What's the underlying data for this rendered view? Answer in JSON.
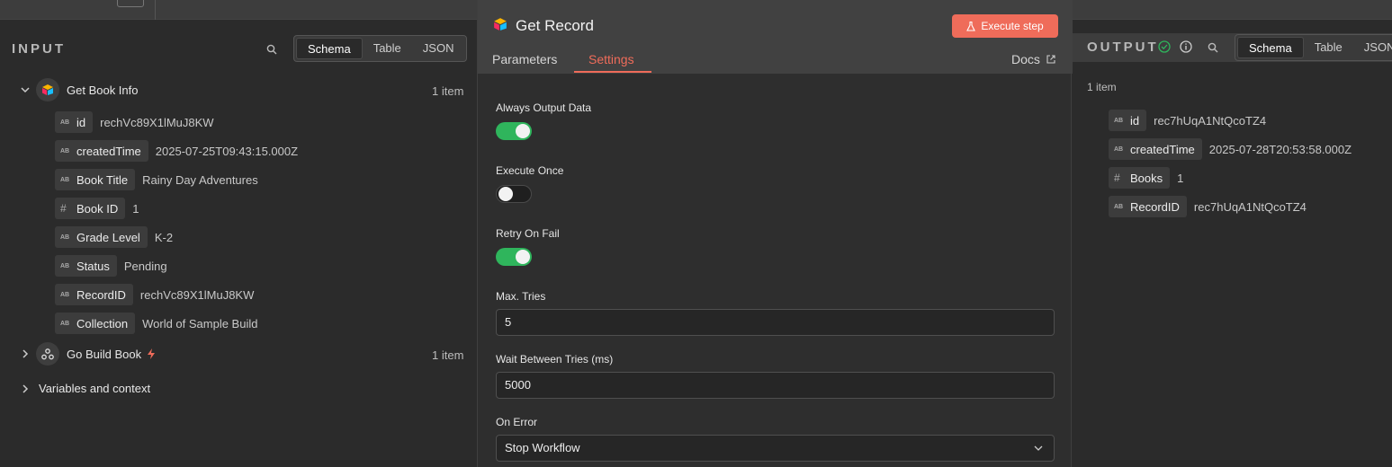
{
  "input": {
    "title": "INPUT",
    "view_tabs": [
      "Schema",
      "Table",
      "JSON"
    ],
    "nodes": [
      {
        "name": "Get Book Info",
        "count": "1 item",
        "fields": [
          {
            "type": "AB",
            "label": "id",
            "value": "rechVc89X1lMuJ8KW"
          },
          {
            "type": "AB",
            "label": "createdTime",
            "value": "2025-07-25T09:43:15.000Z"
          },
          {
            "type": "AB",
            "label": "Book Title",
            "value": "Rainy Day Adventures"
          },
          {
            "type": "#",
            "label": "Book ID",
            "value": "1"
          },
          {
            "type": "AB",
            "label": "Grade Level",
            "value": "K-2"
          },
          {
            "type": "AB",
            "label": "Status",
            "value": "Pending"
          },
          {
            "type": "AB",
            "label": "RecordID",
            "value": "rechVc89X1lMuJ8KW"
          },
          {
            "type": "AB",
            "label": "Collection",
            "value": "World of Sample Build"
          }
        ]
      },
      {
        "name": "Go Build Book",
        "count": "1 item"
      }
    ],
    "variables_label": "Variables and context"
  },
  "center": {
    "title": "Get Record",
    "execute_label": "Execute step",
    "tabs": [
      "Parameters",
      "Settings"
    ],
    "docs_label": "Docs",
    "settings": {
      "always_output": {
        "label": "Always Output Data",
        "on": true
      },
      "execute_once": {
        "label": "Execute Once",
        "on": false
      },
      "retry_on_fail": {
        "label": "Retry On Fail",
        "on": true
      },
      "max_tries": {
        "label": "Max. Tries",
        "value": "5"
      },
      "wait_between": {
        "label": "Wait Between Tries (ms)",
        "value": "5000"
      },
      "on_error": {
        "label": "On Error",
        "value": "Stop Workflow"
      }
    }
  },
  "output": {
    "title": "OUTPUT",
    "view_tabs": [
      "Schema",
      "Table",
      "JSON"
    ],
    "count": "1 item",
    "fields": [
      {
        "type": "AB",
        "label": "id",
        "value": "rec7hUqA1NtQcoTZ4"
      },
      {
        "type": "AB",
        "label": "createdTime",
        "value": "2025-07-28T20:53:58.000Z"
      },
      {
        "type": "#",
        "label": "Books",
        "value": "1"
      },
      {
        "type": "AB",
        "label": "RecordID",
        "value": "rec7hUqA1NtQcoTZ4"
      }
    ]
  },
  "colors": {
    "accent": "#ef6c5a",
    "toggle_on": "#2fb55c",
    "success": "#2fb55c"
  }
}
